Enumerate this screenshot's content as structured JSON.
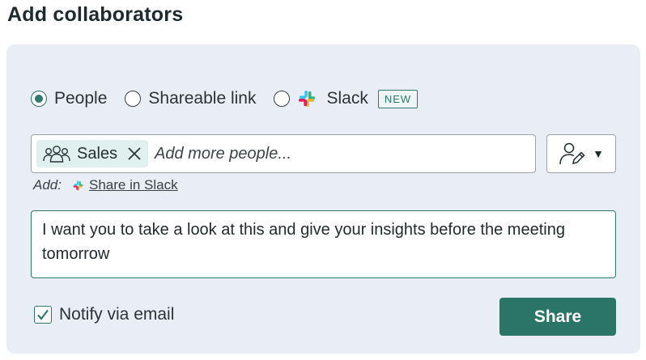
{
  "title": "Add collaborators",
  "share_options": [
    {
      "label": "People",
      "selected": true
    },
    {
      "label": "Shareable link",
      "selected": false
    },
    {
      "label": "Slack",
      "selected": false,
      "badge": "NEW"
    }
  ],
  "people_input": {
    "chips": [
      {
        "label": "Sales",
        "icon": "group-icon"
      }
    ],
    "placeholder": "Add more people..."
  },
  "permission_button": {
    "icon": "user-edit-icon",
    "caret": "▼"
  },
  "add_row": {
    "label": "Add:",
    "link": "Share in Slack"
  },
  "message": "I want you to take a look at this and give your insights before the meeting tomorrow",
  "notify": {
    "label": "Notify via email",
    "checked": true
  },
  "share_button": "Share",
  "colors": {
    "accent": "#2a7468",
    "panel": "#e9edf6",
    "chip": "#dff0ee"
  }
}
